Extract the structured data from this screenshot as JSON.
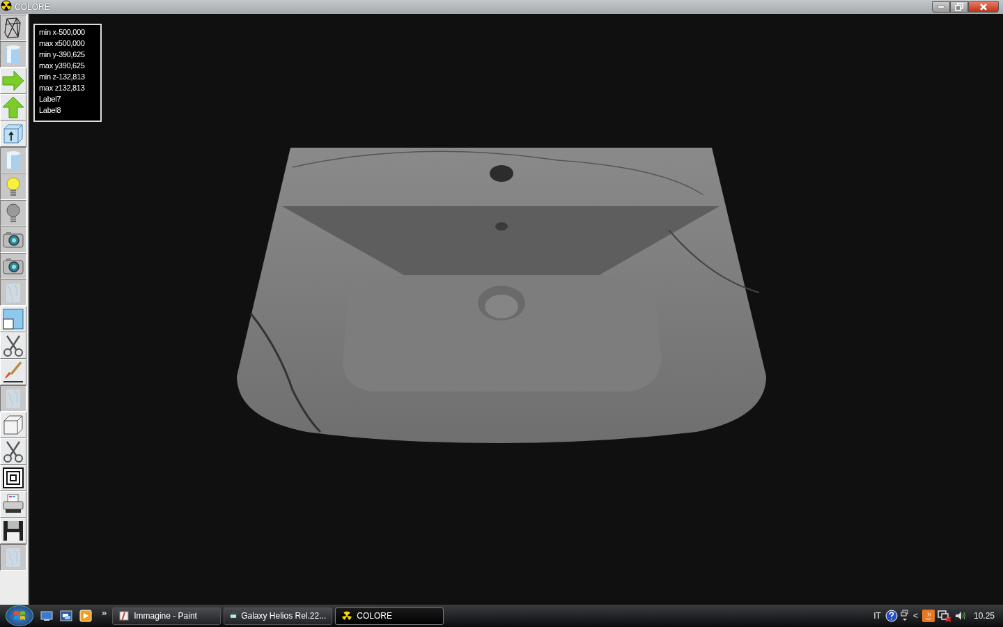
{
  "window": {
    "title": "COLORE",
    "controls": [
      {
        "kind": "minimize"
      },
      {
        "kind": "restore"
      },
      {
        "kind": "close"
      }
    ]
  },
  "toolbar": [
    {
      "kind": "wireframe",
      "pressed": true
    },
    {
      "kind": "cylinder",
      "pressed": true
    },
    {
      "kind": "arrow-right",
      "pressed": false
    },
    {
      "kind": "arrow-up",
      "pressed": false
    },
    {
      "kind": "box-arrow",
      "pressed": false
    },
    {
      "kind": "cylinder",
      "pressed": true
    },
    {
      "kind": "bulb-on",
      "pressed": true
    },
    {
      "kind": "bulb-off",
      "pressed": true
    },
    {
      "kind": "camera",
      "pressed": true
    },
    {
      "kind": "camera",
      "pressed": true
    },
    {
      "kind": "texture",
      "pressed": true
    },
    {
      "kind": "panels",
      "pressed": false
    },
    {
      "kind": "scissors",
      "pressed": false
    },
    {
      "kind": "brush",
      "pressed": false
    },
    {
      "kind": "texture",
      "pressed": true
    },
    {
      "kind": "cube",
      "pressed": false
    },
    {
      "kind": "scissors",
      "pressed": false
    },
    {
      "kind": "concentric",
      "pressed": false
    },
    {
      "kind": "printer",
      "pressed": false
    },
    {
      "kind": "floppy",
      "pressed": false
    },
    {
      "kind": "texture",
      "pressed": true
    }
  ],
  "info_box": [
    "min x-500,000",
    "max x500,000",
    "min y-390,625",
    "max y390,625",
    "min z-132,813",
    "max z132,813",
    "Label7",
    "Label8"
  ],
  "taskbar": {
    "quick_launch": [
      {
        "kind": "desktop"
      },
      {
        "kind": "windows"
      },
      {
        "kind": "media"
      }
    ],
    "more": "»",
    "tasks": [
      {
        "label": "Immagine - Paint",
        "kind": "paint",
        "selected": false
      },
      {
        "label": "Galaxy Helios  Rel.22...",
        "kind": "app",
        "selected": false
      },
      {
        "label": "COLORE",
        "kind": "colore",
        "selected": true
      }
    ],
    "tray": {
      "language": "IT",
      "chevron": "<",
      "clock": "10.25"
    }
  }
}
